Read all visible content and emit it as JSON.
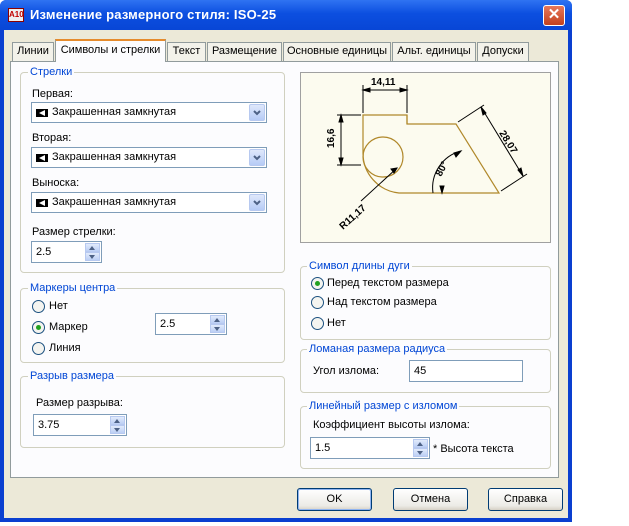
{
  "window": {
    "title": "Изменение размерного стиля: ISO-25",
    "app_icon_text": "A10",
    "close_glyph": "✕"
  },
  "tabs": [
    "Линии",
    "Символы и стрелки",
    "Текст",
    "Размещение",
    "Основные единицы",
    "Альт. единицы",
    "Допуски"
  ],
  "active_tab": "Символы и стрелки",
  "arrows": {
    "group_label": "Стрелки",
    "first_label": "Первая:",
    "first_value": "Закрашенная замкнутая",
    "second_label": "Вторая:",
    "second_value": "Закрашенная замкнутая",
    "leader_label": "Выноска:",
    "leader_value": "Закрашенная замкнутая",
    "size_label": "Размер стрелки:",
    "size_value": "2.5"
  },
  "center_marks": {
    "group_label": "Маркеры центра",
    "options": [
      "Нет",
      "Маркер",
      "Линия"
    ],
    "selected": "Маркер",
    "size_value": "2.5"
  },
  "dim_break": {
    "group_label": "Разрыв размера",
    "size_label": "Размер разрыва:",
    "size_value": "3.75"
  },
  "preview": {
    "dims": [
      "14,11",
      "16,6",
      "28,07",
      "80°",
      "R11,17"
    ],
    "colors": {
      "background": "#fcfbef",
      "geometry": "#b0882a",
      "dimensions": "#000000"
    }
  },
  "arc_length": {
    "group_label": "Символ длины дуги",
    "options": [
      "Перед текстом размера",
      "Над текстом размера",
      "Нет"
    ],
    "selected": "Перед текстом размера"
  },
  "radius_jog": {
    "group_label": "Ломаная размера радиуса",
    "angle_label": "Угол излома:",
    "angle_value": "45"
  },
  "linear_jog": {
    "group_label": "Линейный размер с изломом",
    "factor_label": "Коэффициент высоты излома:",
    "factor_value": "1.5",
    "factor_suffix": "* Высота текста"
  },
  "buttons": {
    "ok": "OK",
    "cancel": "Отмена",
    "help": "Справка"
  },
  "colors": {
    "titlebar": "#0c4fe0",
    "group_label": "#0046d5",
    "tab_highlight": "#e68b2c",
    "dialog_bg": "#ece9d8"
  }
}
